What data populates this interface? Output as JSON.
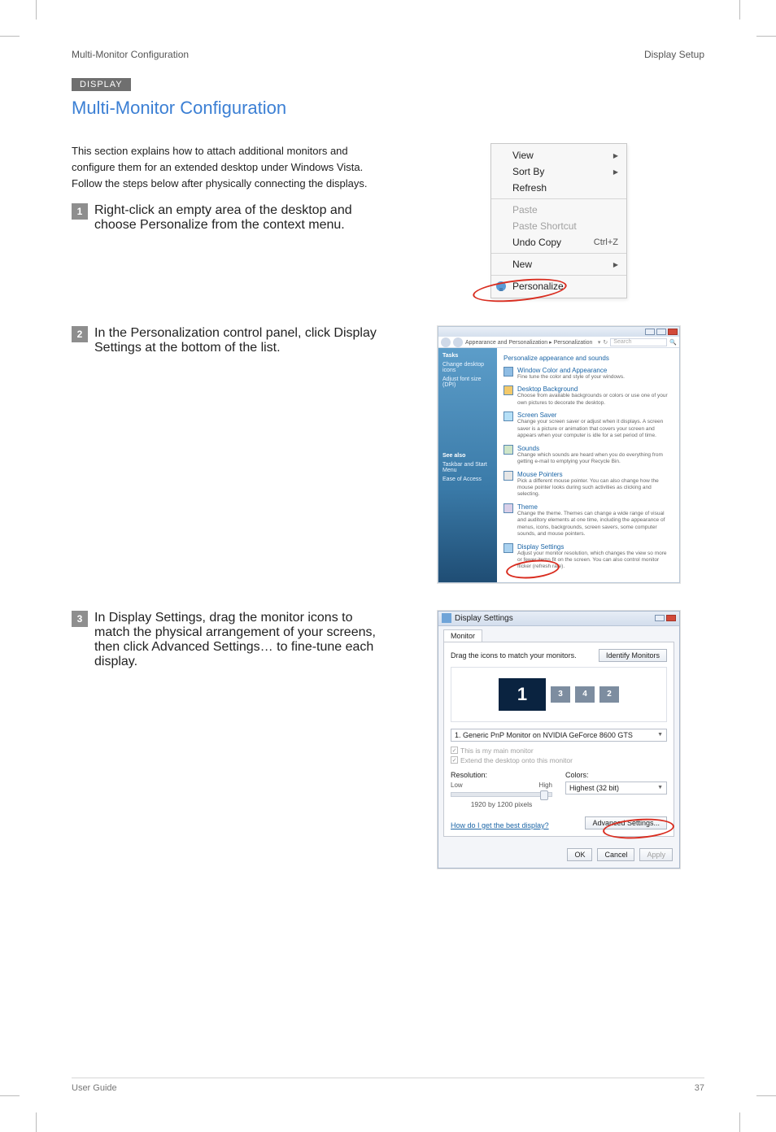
{
  "header": {
    "manual_title": "Multi-Monitor Configuration",
    "chapter": "Display Setup"
  },
  "section_tag": "DISPLAY",
  "page_title": "Multi-Monitor Configuration",
  "intro": "This section explains how to attach additional monitors and configure them for an extended desktop under Windows Vista. Follow the steps below after physically connecting the displays.",
  "steps": {
    "s1_bullet": "1",
    "s1_text": "Right-click an empty area of the desktop and choose Personalize from the context menu.",
    "s2_bullet": "2",
    "s2_text": "In the Personalization control panel, click Display Settings at the bottom of the list.",
    "s3_bullet": "3",
    "s3_text": "In Display Settings, drag the monitor icons to match the physical arrangement of your screens, then click Advanced Settings… to fine-tune each display."
  },
  "context_menu": {
    "view": "View",
    "sort_by": "Sort By",
    "refresh": "Refresh",
    "paste": "Paste",
    "paste_shortcut": "Paste Shortcut",
    "undo_copy": "Undo Copy",
    "undo_copy_shortcut": "Ctrl+Z",
    "new": "New",
    "personalize": "Personalize"
  },
  "cp": {
    "breadcrumb": "Appearance and Personalization  ▸  Personalization",
    "search_placeholder": "Search",
    "side_tasks": "Tasks",
    "side_link1": "Change desktop icons",
    "side_link2": "Adjust font size (DPI)",
    "side_seealso_hdr": "See also",
    "side_seealso1": "Taskbar and Start Menu",
    "side_seealso2": "Ease of Access",
    "heading": "Personalize appearance and sounds",
    "items": [
      {
        "title": "Window Color and Appearance",
        "desc": "Fine tune the color and style of your windows."
      },
      {
        "title": "Desktop Background",
        "desc": "Choose from available backgrounds or colors or use one of your own pictures to decorate the desktop."
      },
      {
        "title": "Screen Saver",
        "desc": "Change your screen saver or adjust when it displays. A screen saver is a picture or animation that covers your screen and appears when your computer is idle for a set period of time."
      },
      {
        "title": "Sounds",
        "desc": "Change which sounds are heard when you do everything from getting e-mail to emptying your Recycle Bin."
      },
      {
        "title": "Mouse Pointers",
        "desc": "Pick a different mouse pointer. You can also change how the mouse pointer looks during such activities as clicking and selecting."
      },
      {
        "title": "Theme",
        "desc": "Change the theme. Themes can change a wide range of visual and auditory elements at one time, including the appearance of menus, icons, backgrounds, screen savers, some computer sounds, and mouse pointers."
      },
      {
        "title": "Display Settings",
        "desc": "Adjust your monitor resolution, which changes the view so more or fewer items fit on the screen. You can also control monitor flicker (refresh rate)."
      }
    ]
  },
  "ds": {
    "title": "Display Settings",
    "tab": "Monitor",
    "instruction": "Drag the icons to match your monitors.",
    "identify": "Identify Monitors",
    "monitors": {
      "m1": "1",
      "m3": "3",
      "m4": "4",
      "m2": "2"
    },
    "selected": "1. Generic PnP Monitor on NVIDIA GeForce 8600 GTS",
    "chk_main": "This is my main monitor",
    "chk_extend": "Extend the desktop onto this monitor",
    "res_label": "Resolution:",
    "res_low": "Low",
    "res_high": "High",
    "res_value": "1920 by 1200 pixels",
    "colors_label": "Colors:",
    "colors_value": "Highest (32 bit)",
    "help_link": "How do I get the best display?",
    "advanced": "Advanced Settings...",
    "ok": "OK",
    "cancel": "Cancel",
    "apply": "Apply"
  },
  "footer": {
    "product": "User Guide",
    "page_no": "37"
  }
}
